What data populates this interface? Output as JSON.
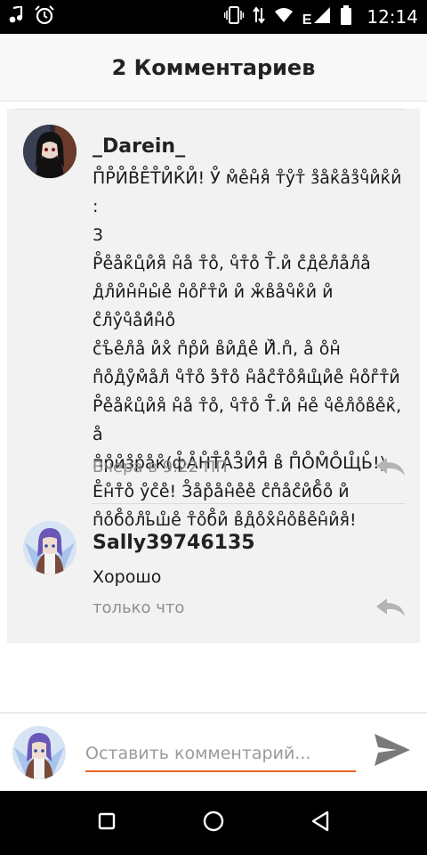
{
  "status_bar": {
    "time": "12:14",
    "network_label": "E",
    "icons": [
      "music-note-icon",
      "alarm-clock-icon",
      "vibrate-icon",
      "network-arrows-icon",
      "wifi-icon",
      "signal-icon",
      "battery-icon"
    ]
  },
  "header": {
    "title": "2 Комментариев"
  },
  "comments": [
    {
      "username": "_Darein_",
      "avatar": "avatar-dark-hair",
      "lines": [
        "П̊Р̊И̊В̊Е̊Т̊И̊К̊И̊! У̊ м̊е̊н̊я̊ т̊у̊т̊ з̊а̊к̊а̊з̊ч̊и̊к̊и̊ :",
        "3",
        "Р̊е̊а̊к̊ц̊и̊я̊ н̊а̊ т̊о̊, ч̊т̊о̊ Т̊.и̊ с̊д̊е̊л̊а̊л̊а̊",
        "д̊л̊и̊н̊н̊ы̊е̊ н̊о̊г̊т̊и̊ и̊ ж̊в̊а̊ч̊к̊и̊ и̊ с̊л̊у̊ч̊а̊й̊н̊о̊",
        "с̊ъ̊е̊л̊а̊ и̊х̊ п̊р̊и̊ в̊и̊д̊е̊ Й̊.п̊, а̊ о̊н̊",
        "п̊о̊д̊у̊м̊а̊л̊ ч̊т̊о̊ э̊т̊о̊ н̊а̊с̊т̊о̊я̊щ̊и̊е̊ н̊о̊г̊т̊и̊",
        "Р̊е̊а̊к̊ц̊и̊я̊ н̊а̊ т̊о̊, ч̊т̊о̊ Т̊.и̊ н̊е̊ ч̊е̊л̊о̊в̊е̊к̊, а̊",
        "п̊р̊и̊з̊р̊а̊к̊(ф̊А̊Н̊Т̊А̊З̊И̊Я̊ в̊ П̊О̊М̊О̊Щ̊Ь̊!)",
        "Е̊н̊т̊о̊ у̊с̊е̊! З̊а̊р̊а̊н̊е̊е̊ с̊п̊а̊с̊и̊б̊о̊ и̊",
        "п̊о̊б̊о̊л̊ь̊ш̊е̊ т̊о̊б̊и̊ в̊д̊о̊х̊н̊о̊в̊е̊н̊и̊я̊!"
      ],
      "time": "Вчера в 9:22 ПП"
    },
    {
      "username": "Sally39746135",
      "avatar": "avatar-purple-hair",
      "lines": [
        "Хорошо"
      ],
      "time": "только что"
    }
  ],
  "compose": {
    "placeholder": "Оставить комментарий...",
    "value": ""
  },
  "nav_bar": {
    "buttons": [
      "recents-square-icon",
      "home-circle-icon",
      "back-triangle-icon"
    ]
  },
  "colors": {
    "accent": "#e8621f",
    "list_background": "#f2f2f2",
    "muted_text": "#8e8e8e"
  }
}
